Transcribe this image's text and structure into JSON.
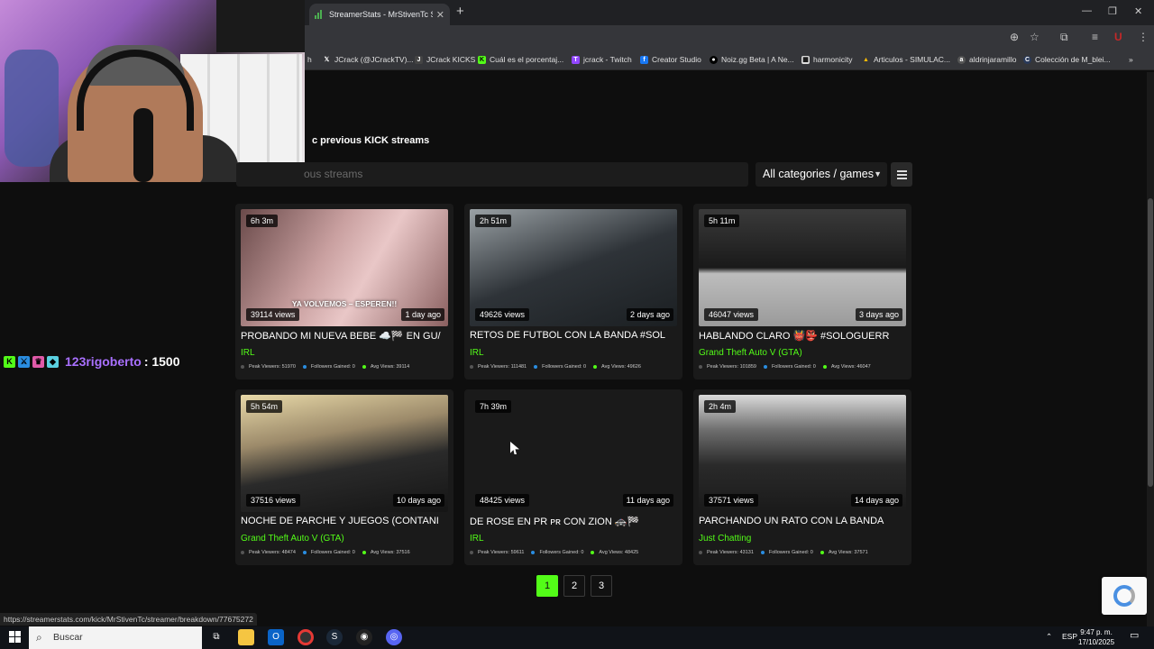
{
  "browser": {
    "tab_title": "StreamerStats - MrStivenTc Stre",
    "new_tab": "+",
    "bookmarks": [
      {
        "label": "h",
        "icon": ""
      },
      {
        "label": "JCrack (@JCrackTV)...",
        "icon": "X"
      },
      {
        "label": "JCrack KICKS",
        "icon": "J"
      },
      {
        "label": "Cuál es el porcentaj...",
        "icon": "K"
      },
      {
        "label": "jcrack - Twitch",
        "icon": "T"
      },
      {
        "label": "Creator Studio",
        "icon": "f"
      },
      {
        "label": "Noiz.gg Beta | A Ne...",
        "icon": "N"
      },
      {
        "label": "harmonicity",
        "icon": "h"
      },
      {
        "label": "Articulos - SIMULAC...",
        "icon": "A"
      },
      {
        "label": "aldrinjaramillo",
        "icon": "a"
      },
      {
        "label": "Colección de M_blei...",
        "icon": "C"
      }
    ],
    "more_bookmarks": "»"
  },
  "page": {
    "section_title": "c previous KICK streams",
    "search_placeholder": "ous streams",
    "category_select": "All categories / games"
  },
  "chat": {
    "user": "123rigoberto",
    "amount": ": 1500"
  },
  "streams": [
    {
      "duration": "6h 3m",
      "views": "39114 views",
      "ago": "1 day ago",
      "title": "PROBANDO MI NUEVA BEBE ☁️🏁 EN GU/",
      "category": "IRL",
      "overlay": "YA VOLVEMOS – ESPEREN!!",
      "peak": "Peak Viewers: 51970",
      "followers": "Followers Gained: 0",
      "avg": "Avg Views: 39114"
    },
    {
      "duration": "2h 51m",
      "views": "49626 views",
      "ago": "2 days ago",
      "title": "RETOS DE FUTBOL CON LA BANDA #SOL",
      "category": "IRL",
      "overlay": "",
      "peak": "Peak Viewers: 111481",
      "followers": "Followers Gained: 0",
      "avg": "Avg Views: 49626"
    },
    {
      "duration": "5h 11m",
      "views": "46047 views",
      "ago": "3 days ago",
      "title": "HABLANDO CLARO 👹👺 #SOLOGUERR",
      "category": "Grand Theft Auto V (GTA)",
      "overlay": "",
      "peak": "Peak Viewers: 101859",
      "followers": "Followers Gained: 0",
      "avg": "Avg Views: 46047"
    },
    {
      "duration": "5h 54m",
      "views": "37516 views",
      "ago": "10 days ago",
      "title": "NOCHE DE PARCHE Y JUEGOS (CONTANI",
      "category": "Grand Theft Auto V (GTA)",
      "overlay": "",
      "peak": "Peak Viewers: 48474",
      "followers": "Followers Gained: 0",
      "avg": "Avg Views: 37516"
    },
    {
      "duration": "7h 39m",
      "views": "48425 views",
      "ago": "11 days ago",
      "title": "DE ROSE EN PR ᴘʀ CON ZION 🚓🏁",
      "category": "IRL",
      "overlay": "",
      "peak": "Peak Viewers: 59611",
      "followers": "Followers Gained: 0",
      "avg": "Avg Views: 48425"
    },
    {
      "duration": "2h 4m",
      "views": "37571 views",
      "ago": "14 days ago",
      "title": "PARCHANDO UN RATO CON LA BANDA",
      "category": "Just Chatting",
      "overlay": "",
      "peak": "Peak Viewers: 43131",
      "followers": "Followers Gained: 0",
      "avg": "Avg Views: 37571"
    }
  ],
  "pagination": [
    "1",
    "2",
    "3"
  ],
  "status_url": "https://streamerstats.com/kick/MrStivenTc/streamer/breakdown/77675272",
  "taskbar": {
    "search": "Buscar",
    "lang": "ESP",
    "time": "9:47 p. m.",
    "date": "17/10/2025"
  },
  "colors": {
    "accent": "#53fc18",
    "chat_user": "#a970ff"
  }
}
